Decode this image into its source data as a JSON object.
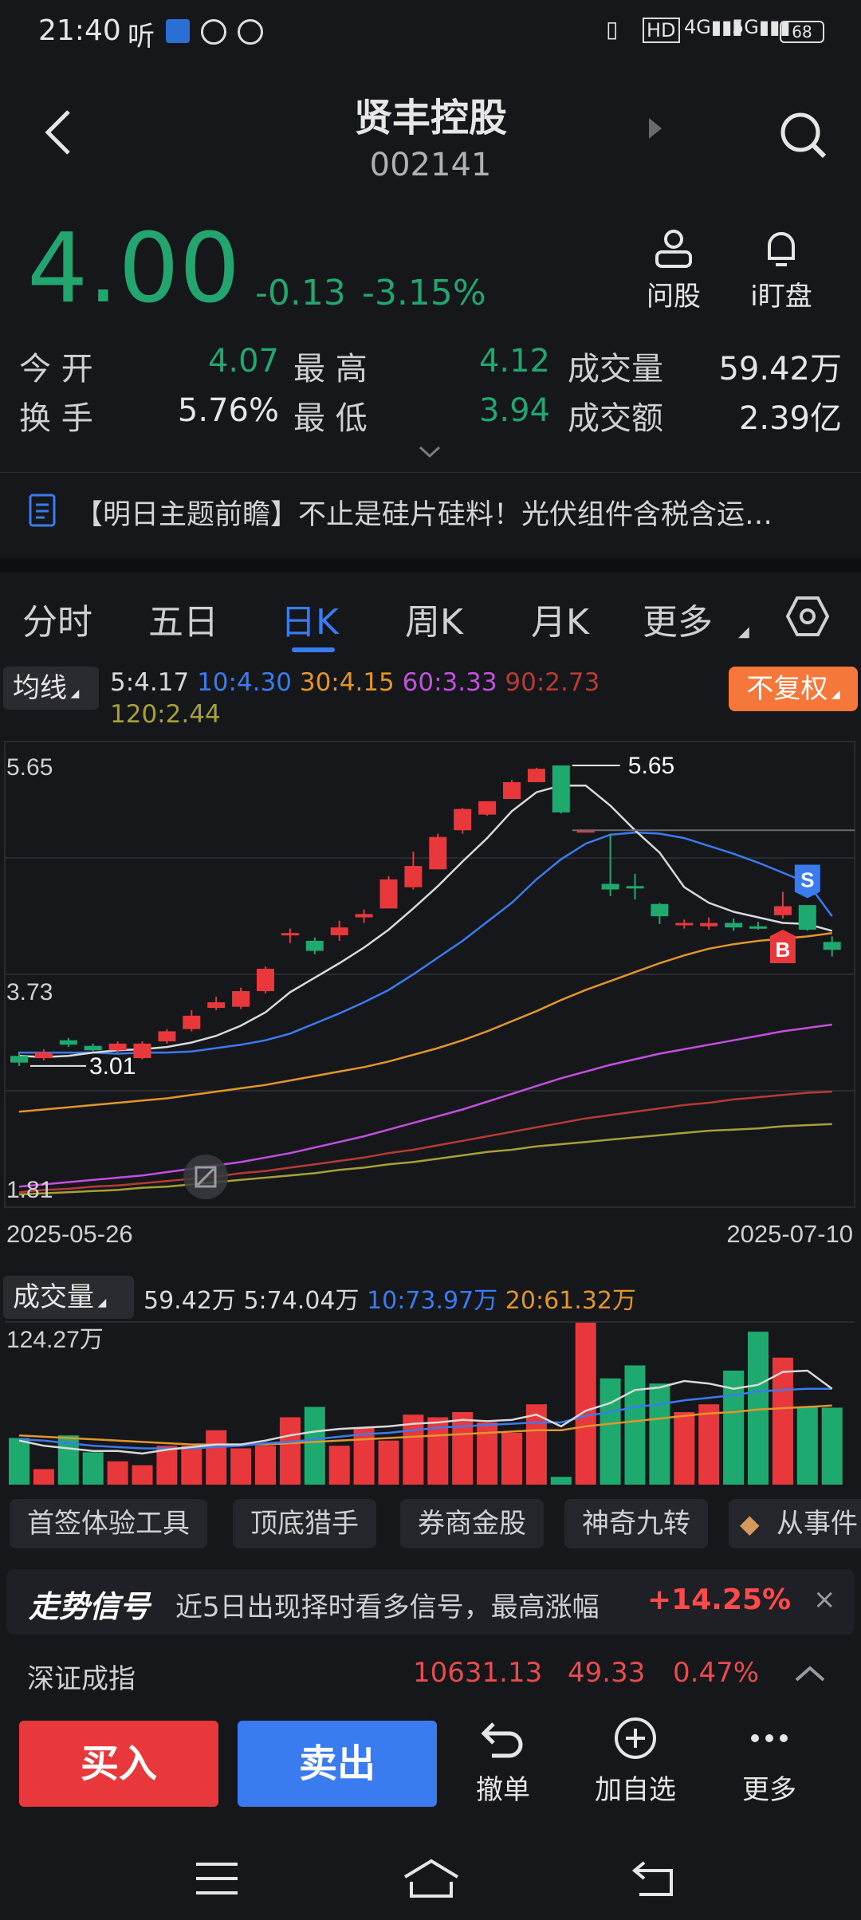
{
  "status_bar": {
    "time": "21:40",
    "listen": "听",
    "battery": "68"
  },
  "header": {
    "stock_name": "贤丰控股",
    "stock_code": "002141",
    "ask_label": "问股",
    "watch_label": "i盯盘"
  },
  "quote": {
    "price": "4.00",
    "change": "-0.13",
    "change_pct": "-3.15%",
    "stats": [
      {
        "label": "今 开",
        "value": "4.07"
      },
      {
        "label": "最 高",
        "value": "4.12"
      },
      {
        "label": "成交量",
        "value": "59.42万"
      },
      {
        "label": "换 手",
        "value": "5.76%"
      },
      {
        "label": "最 低",
        "value": "3.94"
      },
      {
        "label": "成交额",
        "value": "2.39亿"
      }
    ]
  },
  "news": {
    "text": "【明日主题前瞻】不止是硅片硅料！光伏组件含税含运…"
  },
  "tabs": [
    "分时",
    "五日",
    "日K",
    "周K",
    "月K",
    "更多"
  ],
  "ma_bar": {
    "label": "均线",
    "items": [
      {
        "text": "5:4.17",
        "color": "#d9d9d9"
      },
      {
        "text": "10:4.30",
        "color": "#3a7bf0"
      },
      {
        "text": "30:4.15",
        "color": "#e2962a"
      },
      {
        "text": "60:3.33",
        "color": "#c24fe0"
      },
      {
        "text": "90:2.73",
        "color": "#b73b34"
      },
      {
        "text": "120:2.44",
        "color": "#a7a035"
      }
    ],
    "adjust_label": "不复权"
  },
  "chart_data": {
    "type": "candlestick",
    "y_axis_labels": [
      "5.65",
      "3.73",
      "1.81"
    ],
    "ylim": [
      1.81,
      5.65
    ],
    "x_start": "2025-05-26",
    "x_end": "2025-07-10",
    "high_label": "5.65",
    "low_label": "3.01",
    "signal_buy": "B",
    "signal_sell": "S",
    "candles": [
      {
        "o": 3.05,
        "c": 2.99,
        "h": 3.09,
        "l": 2.96
      },
      {
        "o": 3.03,
        "c": 3.08,
        "h": 3.11,
        "l": 3.01
      },
      {
        "o": 3.19,
        "c": 3.15,
        "h": 3.21,
        "l": 3.13
      },
      {
        "o": 3.14,
        "c": 3.1,
        "h": 3.16,
        "l": 3.09
      },
      {
        "o": 3.1,
        "c": 3.16,
        "h": 3.18,
        "l": 3.08
      },
      {
        "o": 3.03,
        "c": 3.16,
        "h": 3.18,
        "l": 3.02
      },
      {
        "o": 3.18,
        "c": 3.27,
        "h": 3.29,
        "l": 3.16
      },
      {
        "o": 3.29,
        "c": 3.41,
        "h": 3.46,
        "l": 3.27
      },
      {
        "o": 3.48,
        "c": 3.53,
        "h": 3.58,
        "l": 3.46
      },
      {
        "o": 3.49,
        "c": 3.63,
        "h": 3.66,
        "l": 3.47
      },
      {
        "o": 3.63,
        "c": 3.83,
        "h": 3.85,
        "l": 3.61
      },
      {
        "o": 4.13,
        "c": 4.15,
        "h": 4.19,
        "l": 4.06
      },
      {
        "o": 4.08,
        "c": 3.99,
        "h": 4.11,
        "l": 3.96
      },
      {
        "o": 4.13,
        "c": 4.2,
        "h": 4.26,
        "l": 4.08
      },
      {
        "o": 4.29,
        "c": 4.32,
        "h": 4.36,
        "l": 4.24
      },
      {
        "o": 4.37,
        "c": 4.63,
        "h": 4.66,
        "l": 4.37
      },
      {
        "o": 4.56,
        "c": 4.75,
        "h": 4.88,
        "l": 4.54
      },
      {
        "o": 4.72,
        "c": 5.01,
        "h": 5.04,
        "l": 4.72
      },
      {
        "o": 5.07,
        "c": 5.26,
        "h": 5.27,
        "l": 5.04
      },
      {
        "o": 5.21,
        "c": 5.33,
        "h": 5.33,
        "l": 5.2
      },
      {
        "o": 5.35,
        "c": 5.5,
        "h": 5.52,
        "l": 5.35
      },
      {
        "o": 5.5,
        "c": 5.62,
        "h": 5.63,
        "l": 5.5
      },
      {
        "o": 5.65,
        "c": 5.23,
        "h": 5.65,
        "l": 5.22
      },
      {
        "o": 5.07,
        "c": 5.07,
        "h": 5.07,
        "l": 5.07
      },
      {
        "o": 4.59,
        "c": 4.54,
        "h": 5.04,
        "l": 4.48
      },
      {
        "o": 4.57,
        "c": 4.56,
        "h": 4.68,
        "l": 4.45
      },
      {
        "o": 4.41,
        "c": 4.3,
        "h": 4.42,
        "l": 4.23
      },
      {
        "o": 4.22,
        "c": 4.24,
        "h": 4.27,
        "l": 4.19
      },
      {
        "o": 4.21,
        "c": 4.24,
        "h": 4.29,
        "l": 4.18
      },
      {
        "o": 4.24,
        "c": 4.2,
        "h": 4.28,
        "l": 4.17
      },
      {
        "o": 4.21,
        "c": 4.19,
        "h": 4.25,
        "l": 4.18
      },
      {
        "o": 4.31,
        "c": 4.39,
        "h": 4.52,
        "l": 4.28
      },
      {
        "o": 4.4,
        "c": 4.18,
        "h": 4.39,
        "l": 4.17
      },
      {
        "o": 4.07,
        "c": 4.0,
        "h": 4.12,
        "l": 3.94
      }
    ],
    "ma5": [
      3.05,
      3.04,
      3.05,
      3.08,
      3.1,
      3.11,
      3.13,
      3.17,
      3.23,
      3.32,
      3.44,
      3.62,
      3.75,
      3.88,
      4.02,
      4.18,
      4.37,
      4.57,
      4.79,
      5.0,
      5.24,
      5.41,
      5.47,
      5.47,
      5.29,
      5.07,
      4.87,
      4.56,
      4.42,
      4.34,
      4.29,
      4.24,
      4.23,
      4.17
    ],
    "ma10": [
      3.08,
      3.08,
      3.08,
      3.08,
      3.07,
      3.08,
      3.08,
      3.09,
      3.12,
      3.15,
      3.19,
      3.25,
      3.34,
      3.43,
      3.53,
      3.64,
      3.78,
      3.93,
      4.08,
      4.25,
      4.42,
      4.63,
      4.81,
      4.95,
      5.03,
      5.05,
      5.04,
      5.0,
      4.93,
      4.86,
      4.78,
      4.69,
      4.6,
      4.3
    ],
    "ma30": [
      2.55,
      2.57,
      2.59,
      2.61,
      2.63,
      2.65,
      2.67,
      2.7,
      2.73,
      2.76,
      2.79,
      2.83,
      2.87,
      2.91,
      2.95,
      3.0,
      3.06,
      3.12,
      3.19,
      3.27,
      3.36,
      3.45,
      3.55,
      3.64,
      3.72,
      3.8,
      3.88,
      3.95,
      4.01,
      4.05,
      4.08,
      4.1,
      4.12,
      4.15
    ],
    "ma60": [
      1.88,
      1.9,
      1.92,
      1.94,
      1.96,
      1.98,
      2.01,
      2.04,
      2.07,
      2.1,
      2.14,
      2.18,
      2.23,
      2.28,
      2.33,
      2.39,
      2.45,
      2.51,
      2.57,
      2.64,
      2.71,
      2.78,
      2.85,
      2.91,
      2.97,
      3.02,
      3.07,
      3.11,
      3.15,
      3.19,
      3.23,
      3.27,
      3.3,
      3.33
    ],
    "ma90": [
      1.83,
      1.85,
      1.86,
      1.88,
      1.89,
      1.91,
      1.93,
      1.95,
      1.97,
      2.0,
      2.02,
      2.05,
      2.08,
      2.11,
      2.14,
      2.18,
      2.21,
      2.25,
      2.29,
      2.33,
      2.37,
      2.41,
      2.45,
      2.49,
      2.52,
      2.55,
      2.58,
      2.61,
      2.63,
      2.66,
      2.68,
      2.7,
      2.72,
      2.73
    ],
    "ma120": [
      1.81,
      1.82,
      1.83,
      1.84,
      1.85,
      1.87,
      1.88,
      1.9,
      1.92,
      1.94,
      1.96,
      1.98,
      2.0,
      2.03,
      2.05,
      2.08,
      2.1,
      2.13,
      2.16,
      2.19,
      2.21,
      2.24,
      2.26,
      2.28,
      2.3,
      2.32,
      2.34,
      2.36,
      2.38,
      2.39,
      2.4,
      2.42,
      2.43,
      2.44
    ]
  },
  "volume": {
    "label": "成交量",
    "values_text": [
      {
        "text": "59.42万",
        "color": "#d9d9d9"
      },
      {
        "text": "5:74.04万",
        "color": "#d9d9d9"
      },
      {
        "text": "10:73.97万",
        "color": "#3a7bf0"
      },
      {
        "text": "20:61.32万",
        "color": "#e2962a"
      }
    ],
    "max_label": "124.27万",
    "max_value": 124.27,
    "bars": [
      36,
      12,
      38,
      25,
      18,
      15,
      30,
      30,
      42,
      28,
      30,
      52,
      60,
      30,
      44,
      34,
      54,
      52,
      56,
      48,
      40,
      62,
      6,
      125,
      82,
      92,
      78,
      56,
      62,
      88,
      118,
      98,
      60,
      59.42
    ],
    "ma5": [
      34,
      30,
      28,
      26,
      26,
      24,
      27,
      29,
      31,
      31,
      34,
      38,
      41,
      43,
      44,
      45,
      47,
      48,
      50,
      49,
      50,
      54,
      45,
      57,
      63,
      73,
      75,
      80,
      78,
      74,
      77,
      87,
      88,
      74
    ],
    "ma10": [
      35,
      34,
      32,
      30,
      29,
      28,
      28,
      28,
      29,
      30,
      32,
      33,
      35,
      37,
      39,
      40,
      42,
      44,
      45,
      46,
      47,
      48,
      48,
      53,
      56,
      60,
      62,
      65,
      67,
      69,
      72,
      73,
      74,
      74
    ],
    "ma20": [
      38,
      37,
      36,
      35,
      34,
      33,
      32,
      31,
      31,
      31,
      31,
      32,
      33,
      34,
      35,
      36,
      37,
      38,
      39,
      40,
      41,
      42,
      42,
      45,
      47,
      49,
      51,
      53,
      55,
      56,
      58,
      59,
      60,
      61
    ]
  },
  "chips": [
    "首签体验工具",
    "顶底猎手",
    "券商金股",
    "神奇九转",
    "从事件"
  ],
  "signal": {
    "title": "走势信号",
    "text": "近5日出现择时看多信号，最高涨幅",
    "gain": "+14.25%"
  },
  "index": {
    "name": "深证成指",
    "value": "10631.13",
    "change": "49.33",
    "pct": "0.47%"
  },
  "trade": {
    "buy": "买入",
    "sell": "卖出",
    "actions": [
      "撤单",
      "加自选",
      "更多"
    ]
  },
  "colors": {
    "up": "#e8383b",
    "down": "#1eaa6f",
    "accent": "#3a7bf0",
    "adjust_bg": "#f5783a"
  }
}
